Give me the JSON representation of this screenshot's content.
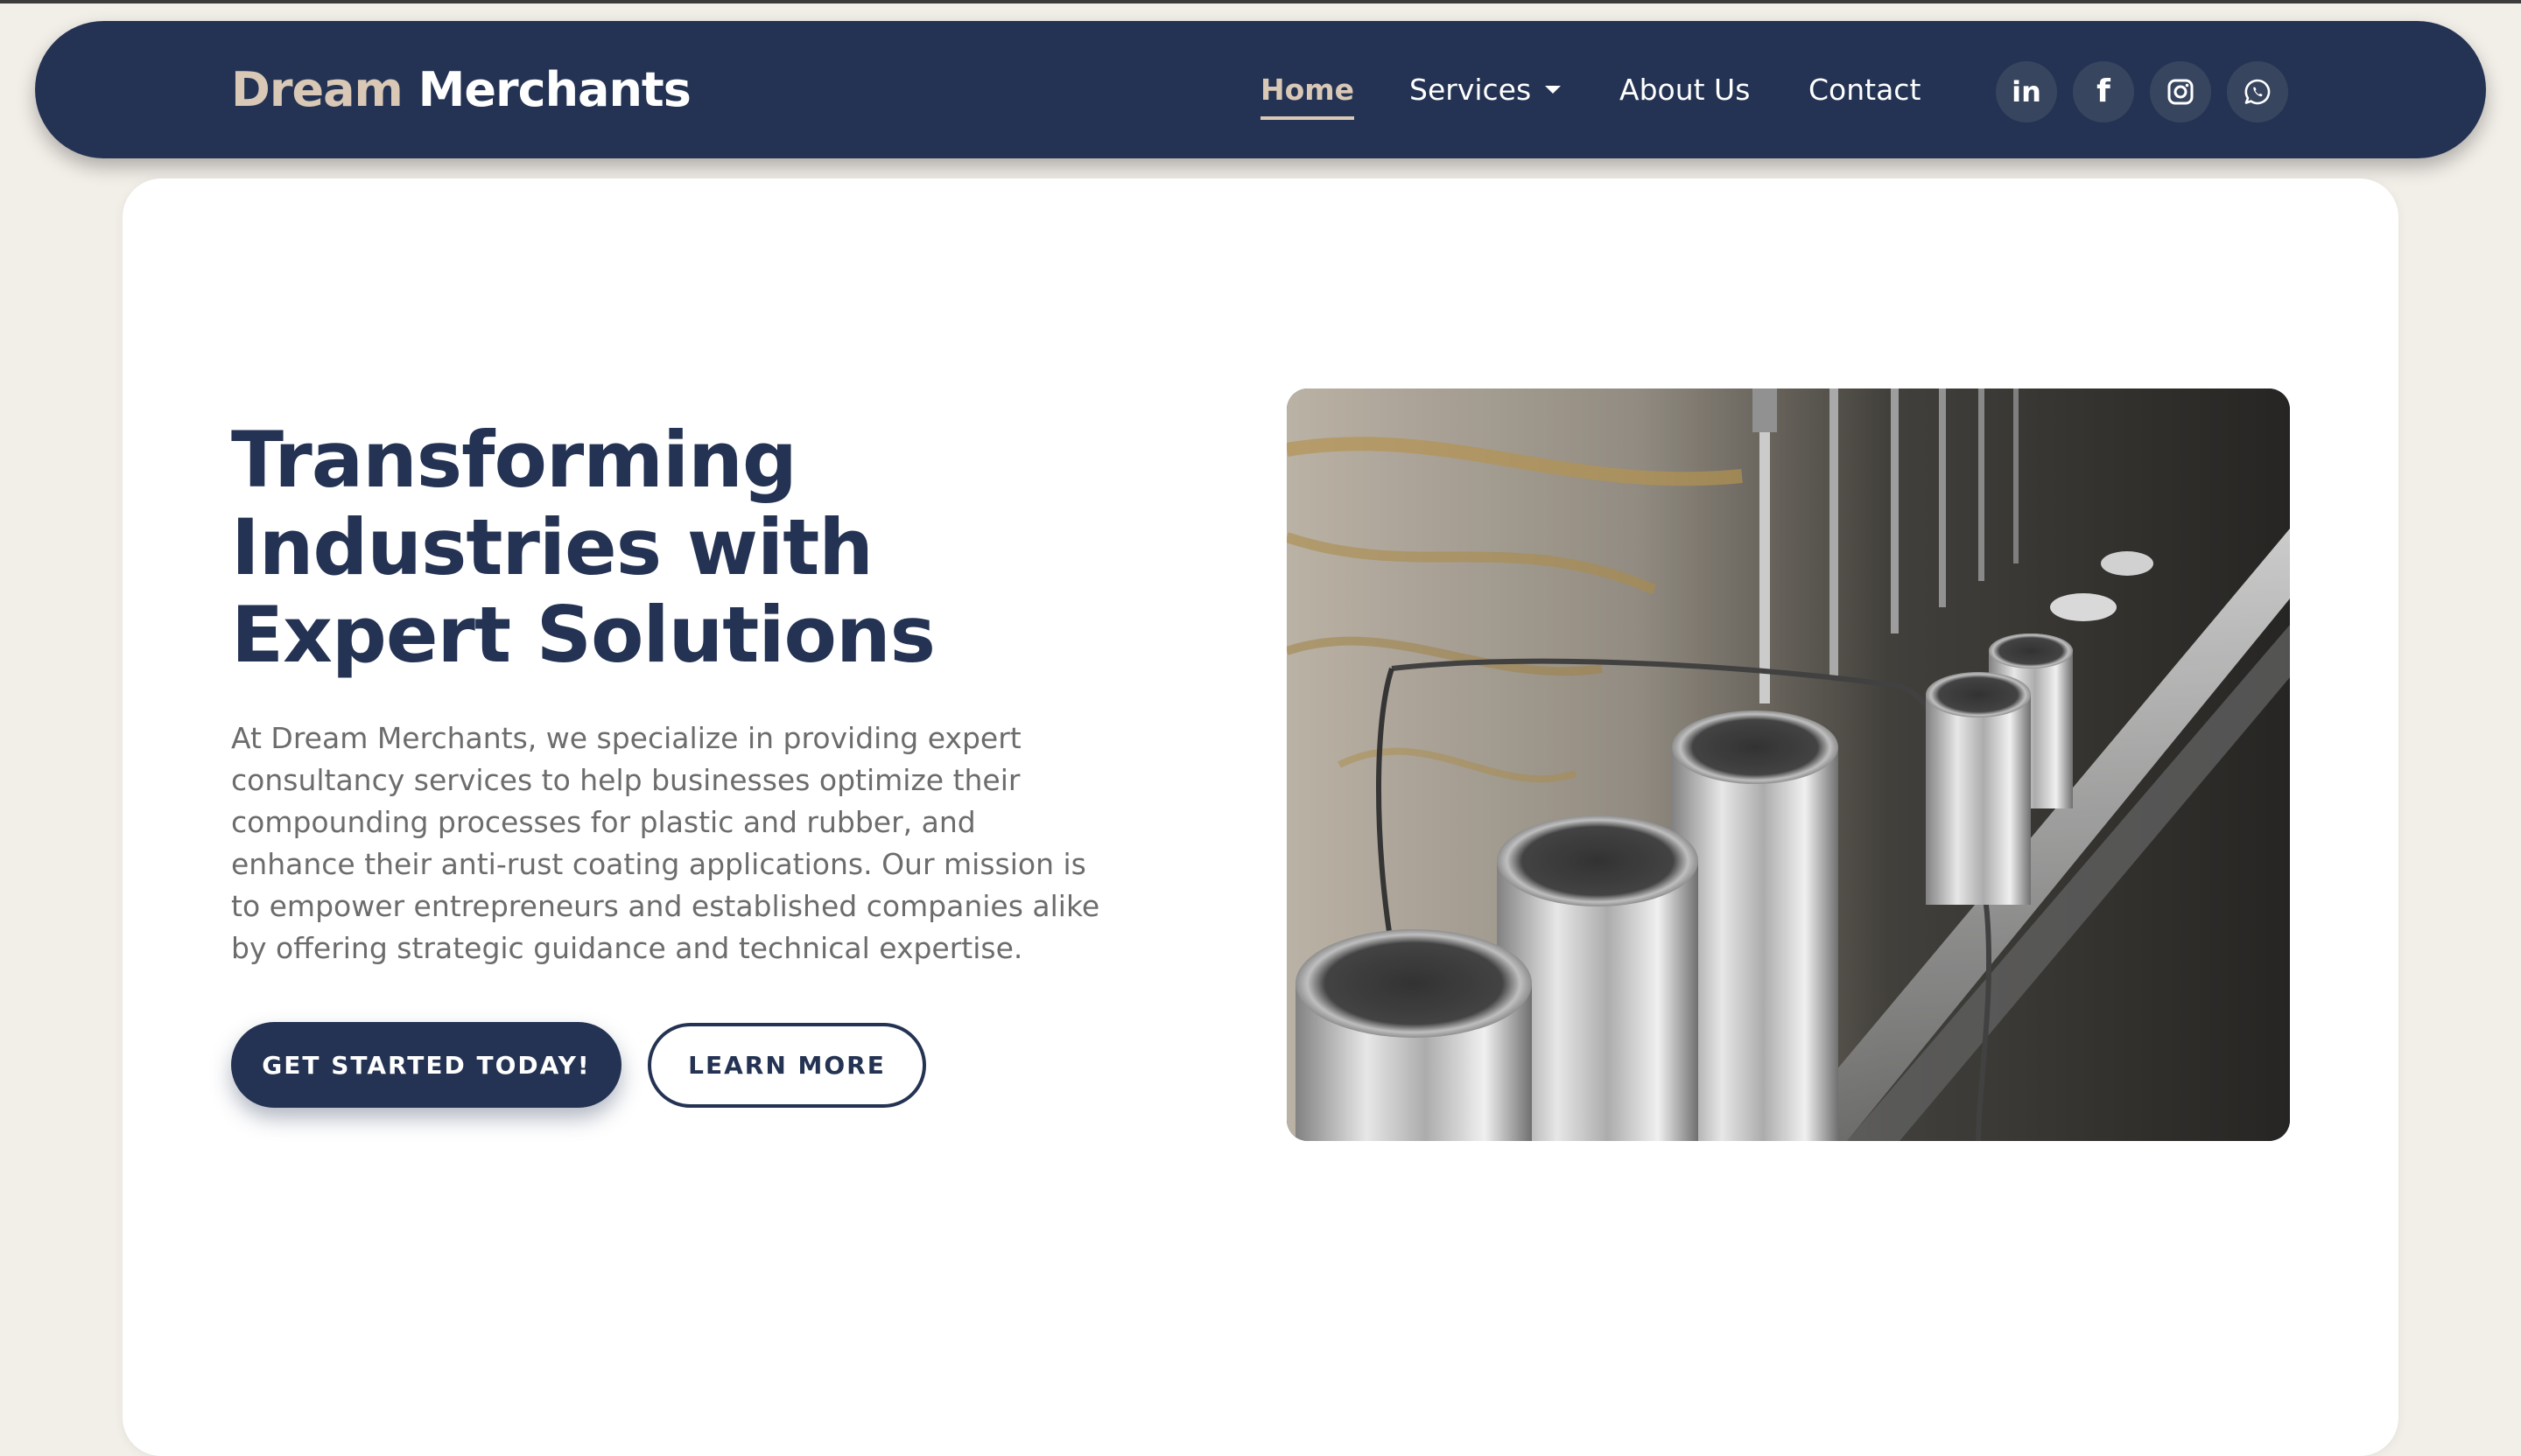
{
  "brand": {
    "part1": "Dream",
    "part2": "Merchants"
  },
  "nav": {
    "items": [
      {
        "label": "Home",
        "active": true
      },
      {
        "label": "Services",
        "has_dropdown": true
      },
      {
        "label": "About Us"
      },
      {
        "label": "Contact"
      }
    ]
  },
  "social": {
    "items": [
      {
        "icon": "linkedin-icon",
        "glyph": "in"
      },
      {
        "icon": "facebook-icon",
        "glyph": "f"
      },
      {
        "icon": "instagram-icon"
      },
      {
        "icon": "whatsapp-icon"
      }
    ]
  },
  "hero": {
    "title_lines": [
      "Transforming",
      "Industries with",
      "Expert Solutions"
    ],
    "description": "At Dream Merchants, we specialize in providing expert consultancy services to help businesses optimize their compounding processes for plastic and rubber, and enhance their anti-rust coating applications. Our mission is to empower entrepreneurs and established companies alike by offering strategic guidance and technical expertise.",
    "primary_button": "GET STARTED TODAY!",
    "secondary_button": "LEARN MORE"
  },
  "colors": {
    "navy": "#243353",
    "beige": "#d9c8b6",
    "page_background": "#f2eee8",
    "body_text": "#6c6c6c"
  }
}
